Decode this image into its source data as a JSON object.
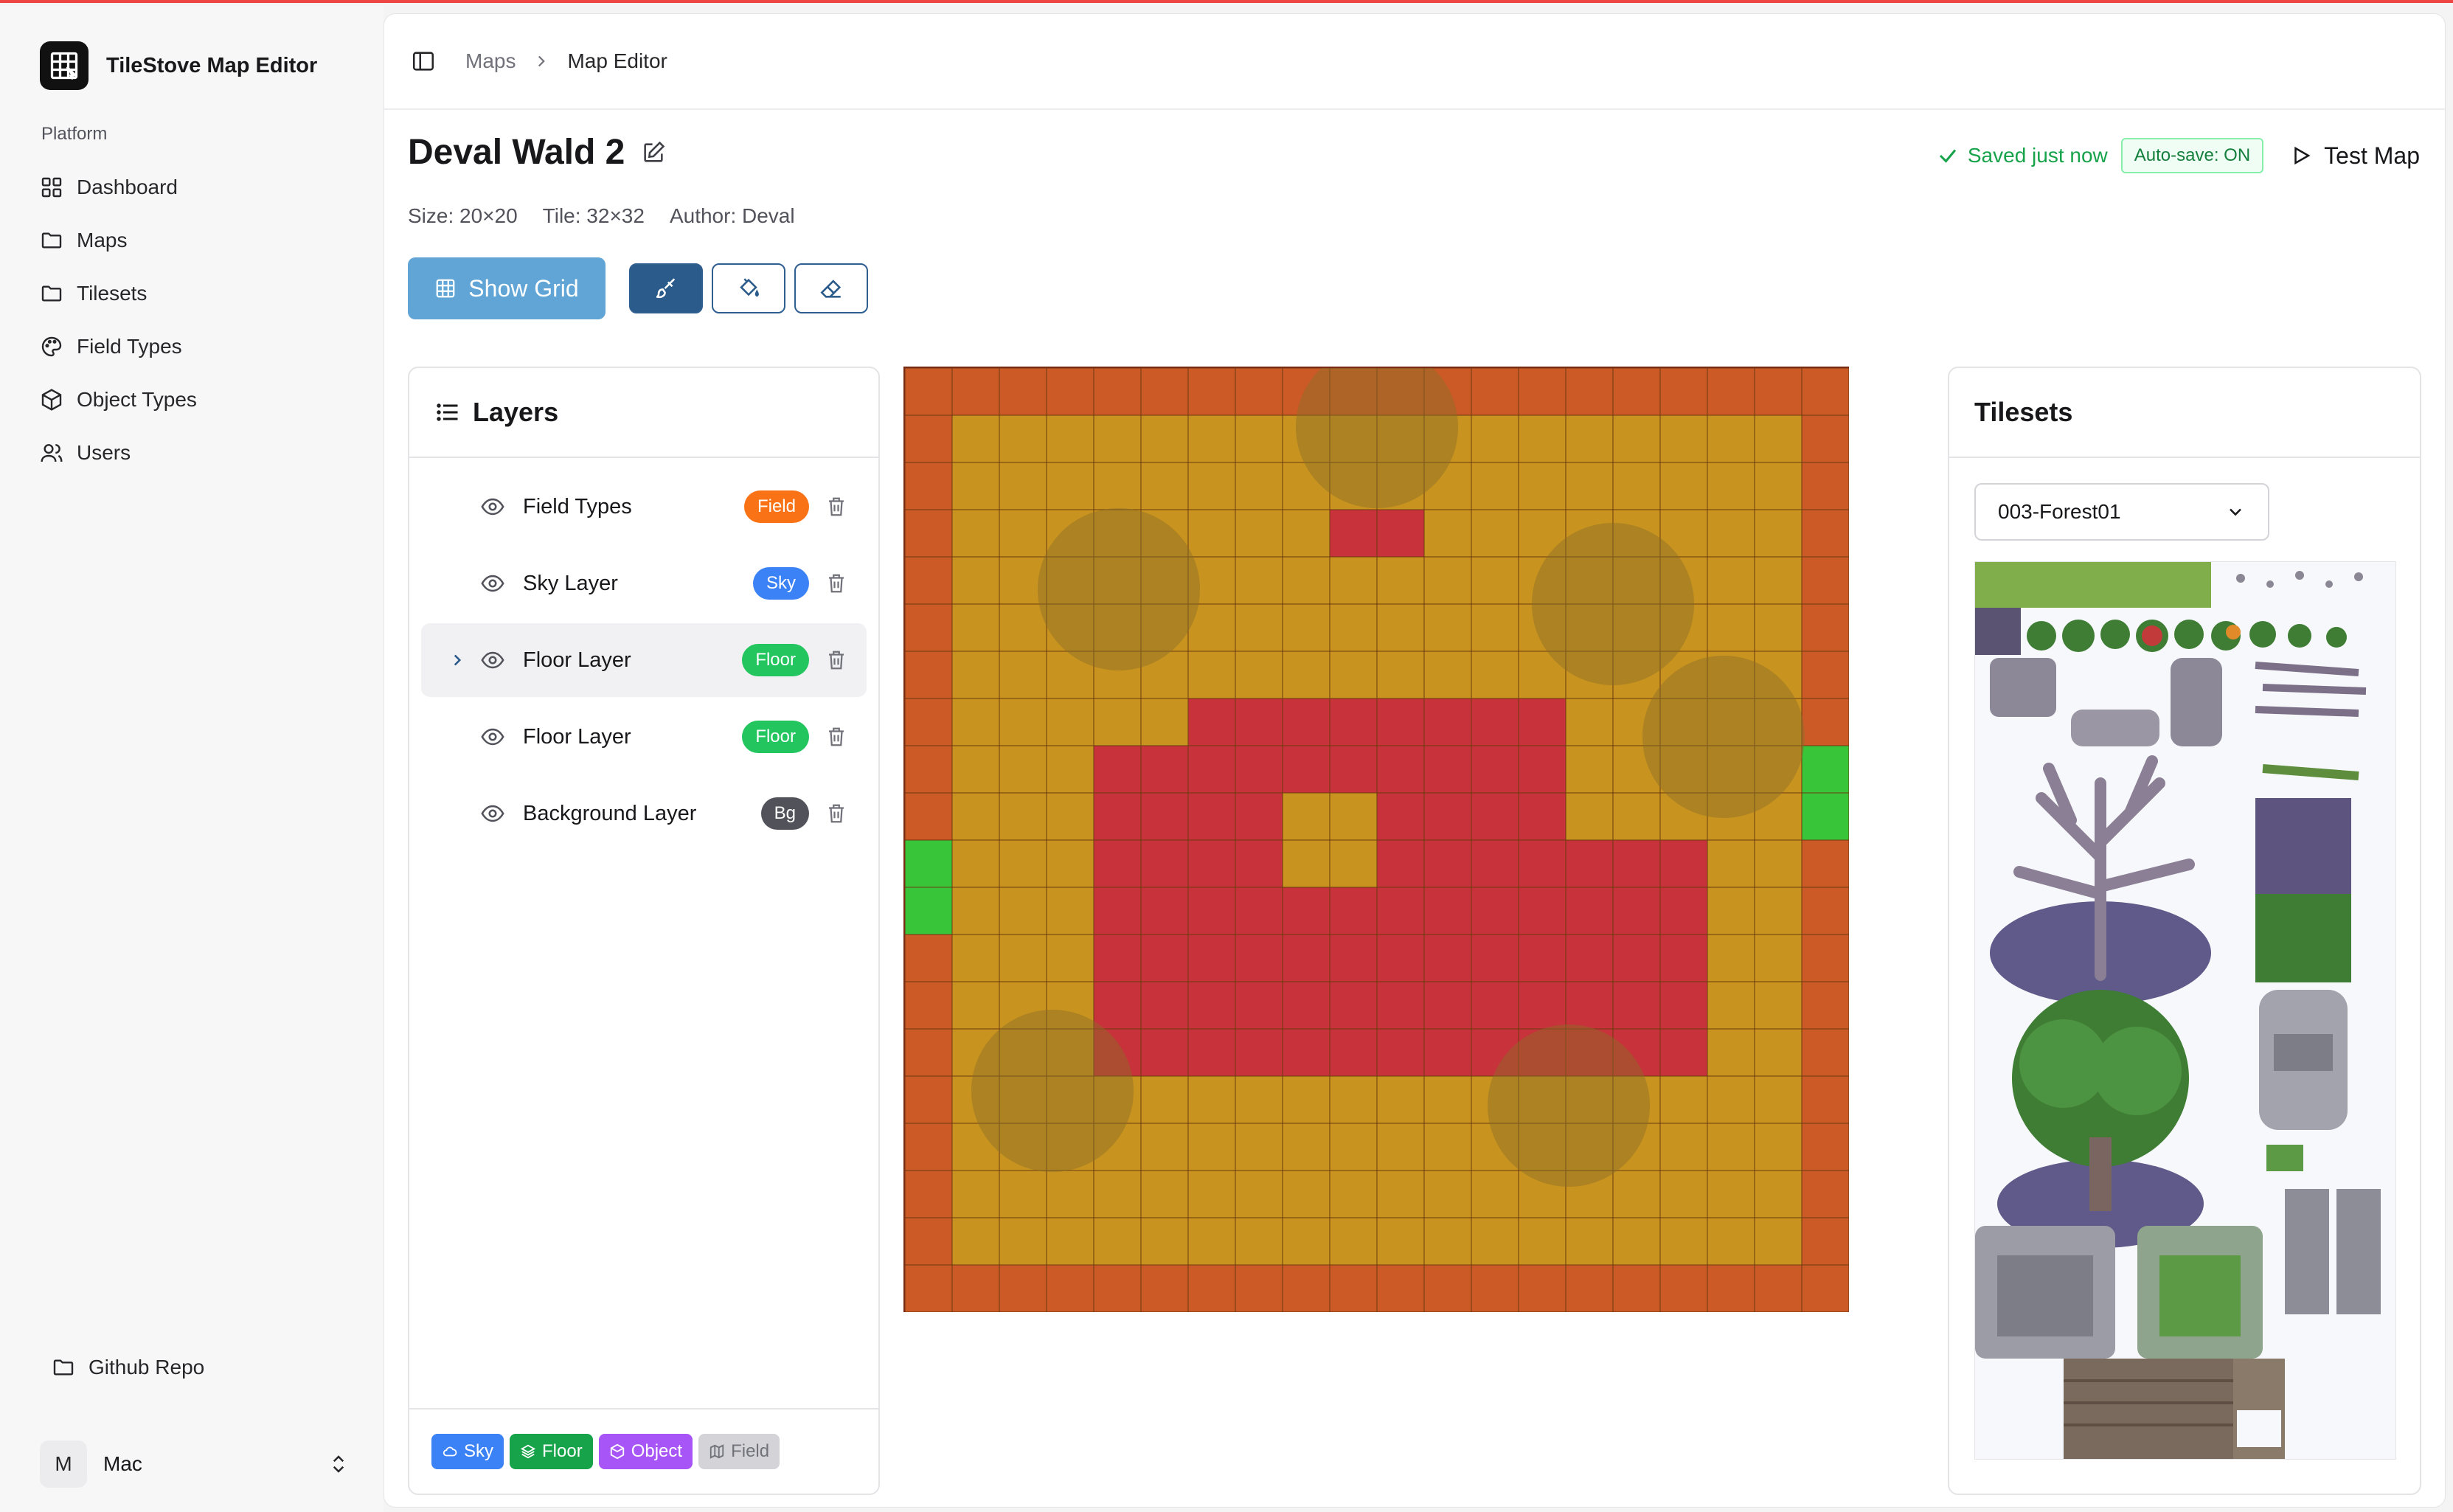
{
  "app": {
    "name": "TileStove Map Editor"
  },
  "sidebar": {
    "group_label": "Platform",
    "items": [
      {
        "label": "Dashboard",
        "icon": "dashboard-icon"
      },
      {
        "label": "Maps",
        "icon": "folder-icon"
      },
      {
        "label": "Tilesets",
        "icon": "folder-icon"
      },
      {
        "label": "Field Types",
        "icon": "palette-icon"
      },
      {
        "label": "Object Types",
        "icon": "box-icon"
      },
      {
        "label": "Users",
        "icon": "users-icon"
      }
    ],
    "github": "Github Repo",
    "user": {
      "initial": "M",
      "name": "Mac"
    }
  },
  "breadcrumb": {
    "parent": "Maps",
    "current": "Map Editor"
  },
  "map": {
    "title": "Deval Wald 2",
    "size": "Size: 20×20",
    "tile": "Tile: 32×32",
    "author": "Author: Deval",
    "grid_cols": 20,
    "grid_rows": 20
  },
  "status": {
    "saved": "Saved just now",
    "autosave": "Auto-save: ON",
    "test_label": "Test Map"
  },
  "toolbar": {
    "show_grid": "Show Grid",
    "tools": [
      "brush-icon",
      "fill-icon",
      "eraser-icon"
    ]
  },
  "layers": {
    "title": "Layers",
    "items": [
      {
        "name": "Field Types",
        "badge": "Field",
        "color": "#f97316"
      },
      {
        "name": "Sky Layer",
        "badge": "Sky",
        "color": "#3b82f6"
      },
      {
        "name": "Floor Layer",
        "badge": "Floor",
        "color": "#22c55e"
      },
      {
        "name": "Floor Layer",
        "badge": "Floor",
        "color": "#22c55e"
      },
      {
        "name": "Background Layer",
        "badge": "Bg",
        "color": "#52525b"
      }
    ],
    "add_buttons": [
      {
        "label": "Sky",
        "color": "#3b82f6"
      },
      {
        "label": "Floor",
        "color": "#16a34a"
      },
      {
        "label": "Object",
        "color": "#a855f7"
      },
      {
        "label": "Field",
        "color": "#d4d4d8"
      }
    ]
  },
  "tilesets": {
    "title": "Tilesets",
    "selected": "003-Forest01"
  },
  "colors": {
    "accent": "#2a5b8a",
    "grid_button": "#60a5d6",
    "saved": "#16a34a"
  }
}
